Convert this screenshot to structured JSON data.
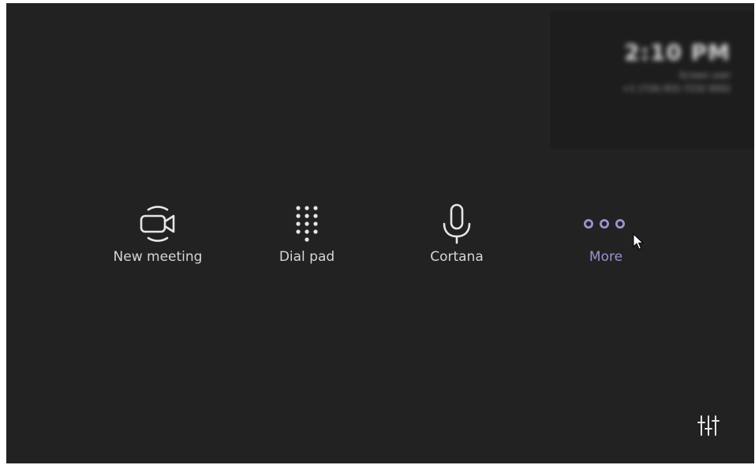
{
  "clock": {
    "time": "2:10 PM",
    "line1": "Screen user",
    "line2": "+1 (716) 831-7232 0002"
  },
  "actions": [
    {
      "label": "New meeting",
      "icon": "video-camera-icon"
    },
    {
      "label": "Dial pad",
      "icon": "dial-pad-icon"
    },
    {
      "label": "Cortana",
      "icon": "microphone-icon"
    },
    {
      "label": "More",
      "icon": "more-dots-icon"
    }
  ],
  "settings": {
    "icon": "settings-sliders-icon"
  },
  "colors": {
    "background": "#222222",
    "text": "#d6d6d6",
    "accent": "#9b93d2"
  }
}
